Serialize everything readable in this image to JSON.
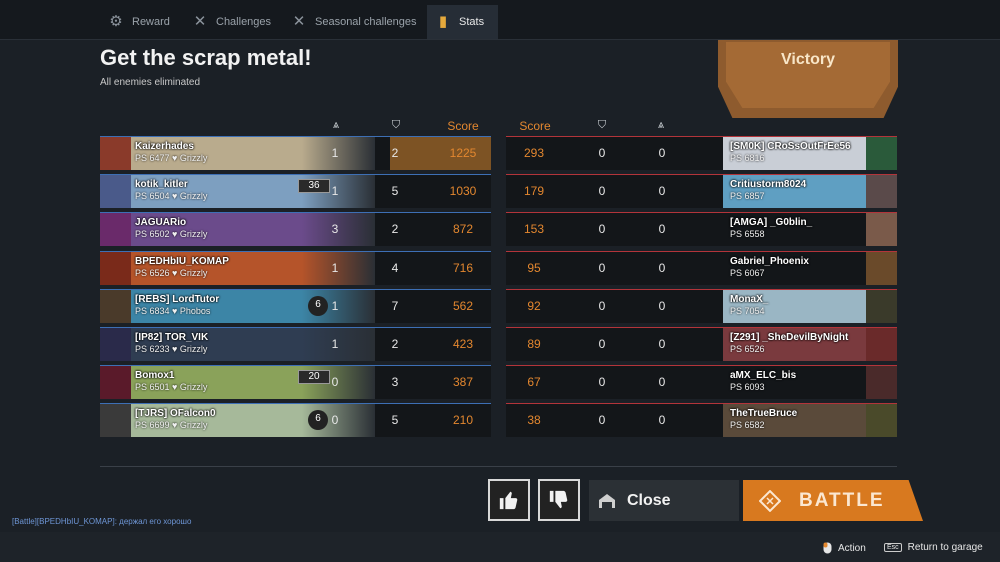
{
  "tabs": [
    {
      "label": "Reward",
      "icon": "reward-icon",
      "active": false
    },
    {
      "label": "Challenges",
      "icon": "crossed-swords-icon",
      "active": false
    },
    {
      "label": "Seasonal challenges",
      "icon": "crossed-swords-icon",
      "active": false
    },
    {
      "label": "Stats",
      "icon": "stats-book-icon",
      "active": true
    }
  ],
  "header": {
    "title": "Get the scrap metal!",
    "subtitle": "All enemies eliminated",
    "result": "Victory"
  },
  "columns": {
    "score": "Score"
  },
  "left_team": [
    {
      "name": "Kaizerhades",
      "ps": "PS 6477",
      "vehicle": "Grizzly",
      "kills": "1",
      "assists": "2",
      "score": "1225",
      "badge": "",
      "plate_color": "#b9ab8d",
      "avatar_color": "#8a3a2a"
    },
    {
      "name": "kotik_kitler",
      "ps": "PS 6504",
      "vehicle": "Grizzly",
      "kills": "1",
      "assists": "5",
      "score": "1030",
      "badge": "36",
      "plate_color": "#7d9fc0",
      "avatar_color": "#4a5a8a"
    },
    {
      "name": "JAGUARio",
      "ps": "PS 6502",
      "vehicle": "Grizzly",
      "kills": "3",
      "assists": "2",
      "score": "872",
      "badge": "",
      "plate_color": "#6b4b8b",
      "avatar_color": "#6a2a6a"
    },
    {
      "name": "BPEDHbIU_KOMAP",
      "ps": "PS 6526",
      "vehicle": "Grizzly",
      "kills": "1",
      "assists": "4",
      "score": "716",
      "badge": "",
      "plate_color": "#b5542a",
      "avatar_color": "#7a2a1a"
    },
    {
      "name": "[REBS] LordTutor",
      "ps": "PS 6834",
      "vehicle": "Phobos",
      "kills": "1",
      "assists": "7",
      "score": "562",
      "badge": "6",
      "plate_color": "#3c85a6",
      "avatar_color": "#4a3a2a"
    },
    {
      "name": "[IP82] TOR_VIK",
      "ps": "PS 6233",
      "vehicle": "Grizzly",
      "kills": "1",
      "assists": "2",
      "score": "423",
      "badge": "",
      "plate_color": "#2f3d52",
      "avatar_color": "#2a2a4a"
    },
    {
      "name": "Bomox1",
      "ps": "PS 6501",
      "vehicle": "Grizzly",
      "kills": "0",
      "assists": "3",
      "score": "387",
      "badge": "20",
      "plate_color": "#8aa25a",
      "avatar_color": "#5a1a2a"
    },
    {
      "name": "[TJRS] OFalcon0",
      "ps": "PS 6699",
      "vehicle": "Grizzly",
      "kills": "0",
      "assists": "5",
      "score": "210",
      "badge": "6",
      "plate_color": "#a6b99a",
      "avatar_color": "#3a3a3a"
    }
  ],
  "right_team": [
    {
      "name": "[SM0K] CRoSsOutFrEe56",
      "ps": "PS 6816",
      "score": "293",
      "assists": "0",
      "kills": "0",
      "plate_color": "#c9ced6",
      "avatar_color": "#2a5a3a"
    },
    {
      "name": "Critiustorm8024",
      "ps": "PS 6857",
      "score": "179",
      "assists": "0",
      "kills": "0",
      "plate_color": "#5f9fc2",
      "avatar_color": "#5a4a4a"
    },
    {
      "name": "[AMGA] _G0blin_",
      "ps": "PS 6558",
      "score": "153",
      "assists": "0",
      "kills": "0",
      "plate_color": "#131619",
      "avatar_color": "#7a5a4a"
    },
    {
      "name": "Gabriel_Phoenix",
      "ps": "PS 6067",
      "score": "95",
      "assists": "0",
      "kills": "0",
      "plate_color": "#131619",
      "avatar_color": "#6a4a2a"
    },
    {
      "name": "MonaX_",
      "ps": "PS 7054",
      "score": "92",
      "assists": "0",
      "kills": "0",
      "plate_color": "#9ab6c4",
      "avatar_color": "#3a3a2a"
    },
    {
      "name": "[Z291] _SheDevilByNight",
      "ps": "PS 6526",
      "score": "89",
      "assists": "0",
      "kills": "0",
      "plate_color": "#7a3a3e",
      "avatar_color": "#6a2a2a"
    },
    {
      "name": "aMX_ELC_bis",
      "ps": "PS 6093",
      "score": "67",
      "assists": "0",
      "kills": "0",
      "plate_color": "#131619",
      "avatar_color": "#4a2a2a"
    },
    {
      "name": "TheTrueBruce",
      "ps": "PS 6582",
      "score": "38",
      "assists": "0",
      "kills": "0",
      "plate_color": "#5a4a3a",
      "avatar_color": "#4a4a2a"
    }
  ],
  "buttons": {
    "close": "Close",
    "battle": "BATTLE"
  },
  "chat": "[Battle][BPEDHbIU_KOMAP]: держал его хорошо",
  "hints": {
    "action": "Action",
    "return": "Return to garage",
    "esc_key": "Esc"
  },
  "colors": {
    "accent_orange": "#e3872f",
    "ally_blue": "#3d6fb5",
    "enemy_red": "#b3343a",
    "battle_button": "#d8791f",
    "banner": "#a46a35"
  }
}
